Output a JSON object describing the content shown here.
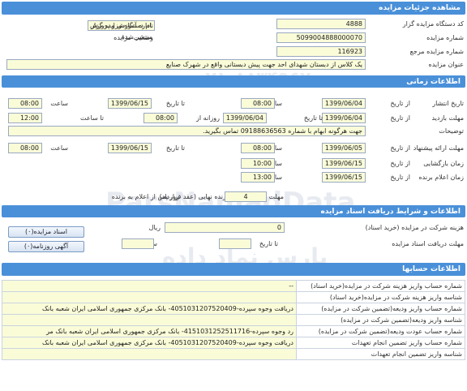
{
  "header": {
    "title": "مشاهده جزئیات مزایده"
  },
  "details": {
    "org_code_label": "کد دستگاه مزایده گزار",
    "org_code": "4888",
    "org_name_label": "نام دستگاه مزایده گزار",
    "org_name": "اداره آموزش و پرورش ناحیه",
    "auction_no_label": "شماره مزایده",
    "auction_no": "5099004888000070",
    "status_label": "وضعیت مزایده",
    "status": "منتشر شده",
    "ref_no_label": "شماره مزایده مرجع",
    "ref_no": "116923",
    "subject_label": "عنوان مزایده",
    "subject": "یک کلاس از دبستان شهدای احد جهت پیش دبستانی  واقع در شهرک صنایع"
  },
  "timing": {
    "title": "اطلاعات زمانی",
    "from_date": "از تاریخ",
    "to_date": "تا تاریخ",
    "hour": "ساعت",
    "to_hour": "تا ساعت",
    "daily": "روزانه از",
    "publish_label": "تاریخ انتشار",
    "publish_from": "1399/06/04",
    "publish_from_time": "08:00",
    "publish_to": "1399/06/15",
    "publish_to_time": "08:00",
    "visit_label": "مهلت بازدید",
    "visit_from": "1399/06/04",
    "visit_to": "1399/06/04",
    "visit_daily_from": "08:00",
    "visit_to_time": "12:00",
    "notes_label": "توضیحات",
    "notes": "جهت هرگونه ابهام با شماره 09188636563 تماس بگیرید.",
    "offer_label": "مهلت ارائه پیشنهاد",
    "offer_from": "1399/06/05",
    "offer_from_time": "08:00",
    "offer_to": "1399/06/15",
    "offer_to_time": "08:00",
    "opening_label": "زمان بازگشایی",
    "opening_date": "1399/06/15",
    "opening_time": "10:00",
    "winner_label": "زمان اعلام برنده",
    "winner_date": "1399/06/15",
    "winner_time": "13:00",
    "contract_prefix": "مهلت زمانی پذیرش برنده نهایی (عقد قرارداد)",
    "contract_days": "4",
    "contract_suffix": "روز پس از اعلام به برنده"
  },
  "docs": {
    "title": "اطلاعات و شرایط دریافت اسناد مزایده",
    "fee_label": "هزینه شرکت در مزایده (خرید اسناد)",
    "fee_value": "0",
    "fee_unit": "ریال",
    "deadline_label": "مهلت دریافت اسناد مزایده",
    "deadline_to": "تا تاریخ",
    "deadline_hour": "ساعت",
    "docs_button": "اسناد مزایده(۰)",
    "newspaper_button": "آگهی روزنامه(۰)"
  },
  "accounts": {
    "title": "اطلاعات حسابها",
    "rows": [
      {
        "label": "شماره حساب واریز هزینه شرکت در مزایده(خرید اسناد)",
        "value": "--"
      },
      {
        "label": "شناسه واریز هزینه شرکت در مزایده(خرید اسناد)",
        "value": ""
      },
      {
        "label": "شماره حساب واریز ودیعه(تضمین شرکت در مزایده)",
        "value": "دریافت وجوه سپرده-4051031207520409- بانک مرکزی جمهوری اسلامی ایران شعبه بانک"
      },
      {
        "label": "شناسه واریز ودیعه(تضمین شرکت در مزایده)",
        "value": ""
      },
      {
        "label": "شماره حساب عودت ودیعه(تضمین شرکت در مزایده)",
        "value": "رد وجوه سپرده-4151031252511716- بانک مرکزی جمهوری اسلامی ایران شعبه بانک مر"
      },
      {
        "label": "شماره حساب واریز تضمین انجام تعهدات",
        "value": "دریافت وجوه سپرده-4051031207520409- بانک مرکزی جمهوری اسلامی ایران شعبه بانک"
      },
      {
        "label": "شناسه واریز تضمین انجام تعهدات",
        "value": ""
      }
    ]
  },
  "watermark": {
    "line1": "ParsNamadData",
    "line2": "پارس نماد داده",
    "line3": "۰۲۱-۸۸۳۴۹۶۷۰"
  }
}
